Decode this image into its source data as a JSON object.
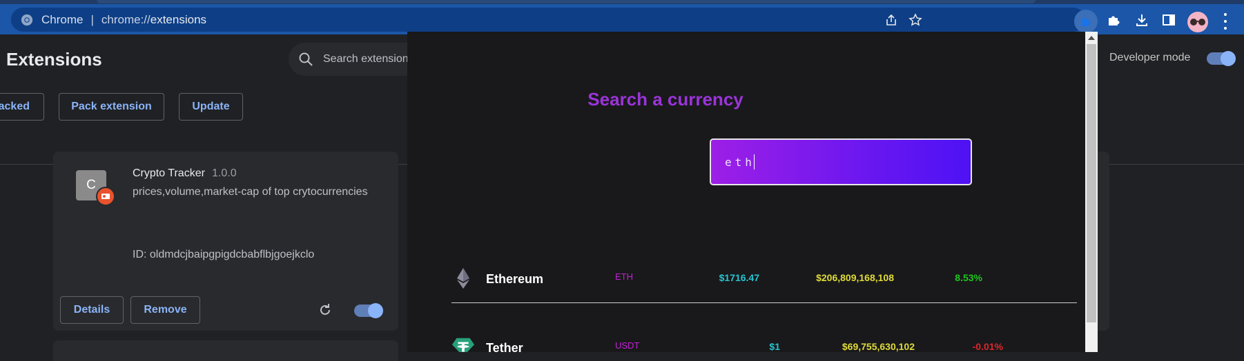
{
  "browser": {
    "omnibox": {
      "scheme": "Chrome",
      "separator": "|",
      "url_prefix": "chrome://",
      "url_path": "extensions"
    }
  },
  "extensions_page": {
    "title": "Extensions",
    "search_placeholder": "Search extensions",
    "developer_mode_label": "Developer mode",
    "developer_mode_on": true,
    "actions": {
      "load_unpacked": "acked",
      "pack": "Pack extension",
      "update": "Update"
    },
    "card": {
      "icon_letter": "C",
      "name": "Crypto Tracker",
      "version": "1.0.0",
      "description": "prices,volume,market-cap of top crytocurrencies",
      "id_text": "ID: oldmdcjbaipgpigdcbabflbjgoejkclo",
      "details_label": "Details",
      "remove_label": "Remove",
      "enabled": true
    }
  },
  "popup": {
    "title": "Search a currency",
    "search_value": "eth",
    "colors": {
      "title": "#9b34d9",
      "symbol": "#c420d8",
      "price": "#27c4d0",
      "market_cap": "#e0dc3a",
      "positive": "#1ec51e",
      "negative": "#e0262a"
    },
    "coins": [
      {
        "name": "Ethereum",
        "symbol": "ETH",
        "price": "$1716.47",
        "market_cap": "$206,809,168,108",
        "change": "8.53%",
        "change_color": "#1ec51e",
        "icon": "ethereum-icon"
      },
      {
        "name": "Tether",
        "symbol": "USDT",
        "price": "$1",
        "market_cap": "$69,755,630,102",
        "change": "-0.01%",
        "change_color": "#e0262a",
        "icon": "tether-icon"
      }
    ]
  }
}
